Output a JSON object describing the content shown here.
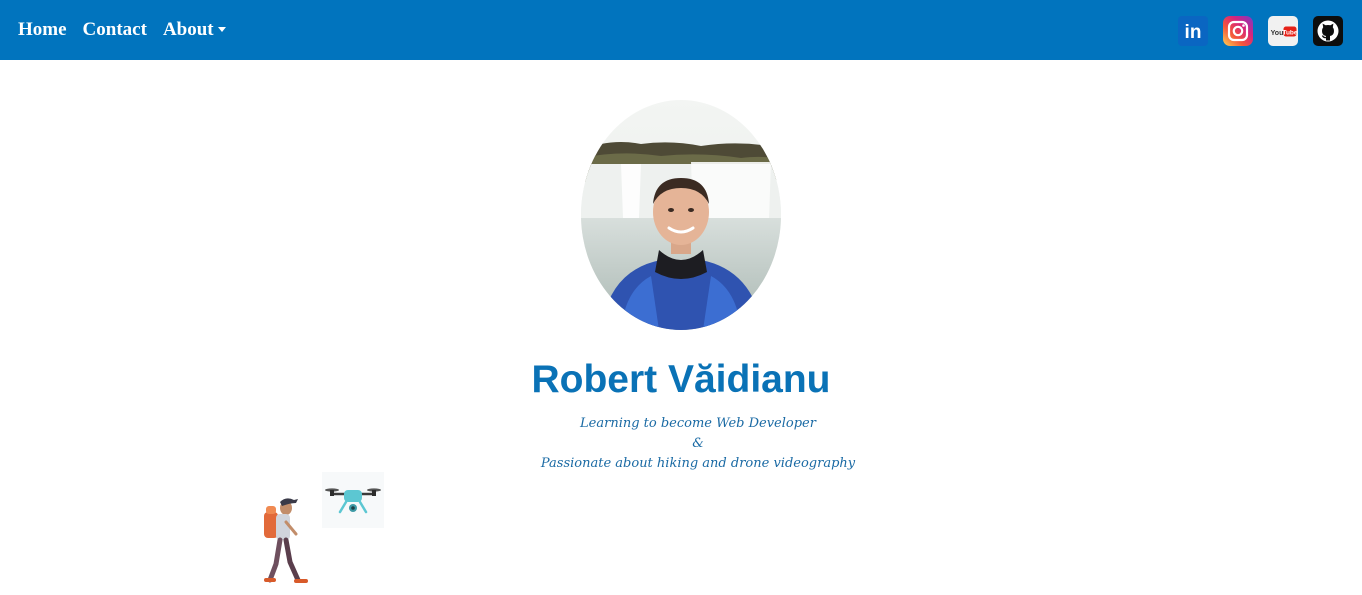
{
  "nav": {
    "home": "Home",
    "contact": "Contact",
    "about": "About"
  },
  "social": {
    "linkedin_text": "in",
    "youtube_text": "You Tube"
  },
  "profile": {
    "name": "Robert Văidianu",
    "tagline_1": "Learning to become Web Developer",
    "tagline_2": "&",
    "tagline_3": "Passionate about hiking and drone videography"
  },
  "colors": {
    "navbar": "#0174be",
    "name": "#0a72b6",
    "tagline": "#1a6aa4"
  }
}
